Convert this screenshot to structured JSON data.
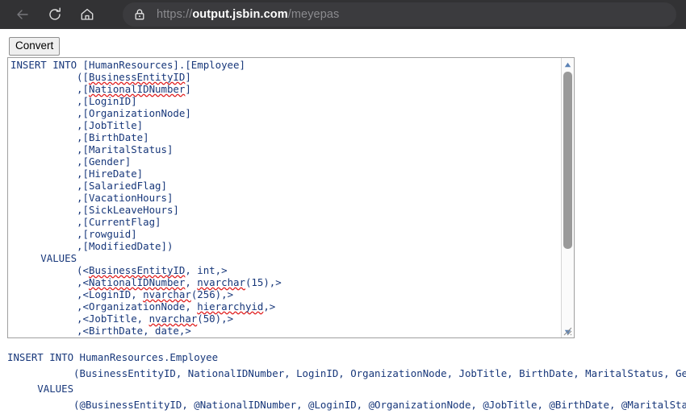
{
  "browser": {
    "nav": {
      "back_icon": "arrow-left-icon",
      "reload_icon": "reload-icon",
      "home_icon": "home-icon"
    },
    "address_bar": {
      "lock_icon": "lock-icon",
      "url_scheme": "https://",
      "url_host": "output.jsbin.com",
      "url_path": "/meyepas"
    },
    "colors": {
      "toolbar_bg": "#323234",
      "addressbar_bg": "#3b3b3e",
      "url_host_color": "#ffffff",
      "url_dim_color": "#8b8b8f"
    }
  },
  "page": {
    "convert_button_label": "Convert",
    "input_textarea": {
      "value": "INSERT INTO [HumanResources].[Employee]\n           ([BusinessEntityID]\n           ,[NationalIDNumber]\n           ,[LoginID]\n           ,[OrganizationNode]\n           ,[JobTitle]\n           ,[BirthDate]\n           ,[MaritalStatus]\n           ,[Gender]\n           ,[HireDate]\n           ,[SalariedFlag]\n           ,[VacationHours]\n           ,[SickLeaveHours]\n           ,[CurrentFlag]\n           ,[rowguid]\n           ,[ModifiedDate])\n     VALUES\n           (<BusinessEntityID, int,>\n           ,<NationalIDNumber, nvarchar(15),>\n           ,<LoginID, nvarchar(256),>\n           ,<OrganizationNode, hierarchyid,>\n           ,<JobTitle, nvarchar(50),>\n           ,<BirthDate, date,>",
      "misspelled_words": [
        "BusinessEntityID",
        "NationalIDNumber",
        "nvarchar",
        "hierarchyid"
      ],
      "scrollbar": {
        "up_arrow_icon": "triangle-up-icon",
        "down_arrow_icon": "triangle-down-icon",
        "resize_grip_icon": "resize-grip-icon"
      }
    },
    "output_text": "INSERT INTO HumanResources.Employee\n           (BusinessEntityID, NationalIDNumber, LoginID, OrganizationNode, JobTitle, BirthDate, MaritalStatus, Gender,\n     VALUES\n           (@BusinessEntityID, @NationalIDNumber, @LoginID, @OrganizationNode, @JobTitle, @BirthDate, @MaritalStatus,",
    "colors": {
      "code_text": "#17377a",
      "spellcheck_underline": "#e02020",
      "textarea_border": "#a0a0a0"
    }
  }
}
